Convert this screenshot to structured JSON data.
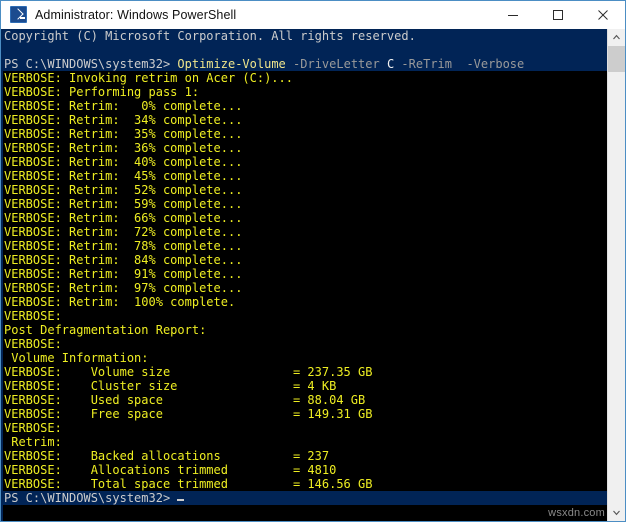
{
  "window": {
    "title": "Administrator: Windows PowerShell",
    "icon": "powershell-icon",
    "border_color": "#4c8ec4",
    "controls": {
      "minimize": "—",
      "maximize": "□",
      "close": "✕"
    }
  },
  "console": {
    "background_navy": "#012456",
    "background_black": "#000000",
    "verbose_color": "#eeee22",
    "prompt_color": "#cccccc",
    "header_line": "Copyright (C) Microsoft Corporation. All rights reserved.",
    "prompt": "PS C:\\WINDOWS\\system32>",
    "command": {
      "cmdlet": "Optimize-Volume",
      "param_drive": "-DriveLetter",
      "drive_value": "C",
      "param_retrim": "-ReTrim",
      "param_verbose": "-Verbose"
    },
    "verbose_lines": [
      "VERBOSE: Invoking retrim on Acer (C:)...",
      "VERBOSE: Performing pass 1:",
      "VERBOSE: Retrim:   0% complete...",
      "VERBOSE: Retrim:  34% complete...",
      "VERBOSE: Retrim:  35% complete...",
      "VERBOSE: Retrim:  36% complete...",
      "VERBOSE: Retrim:  40% complete...",
      "VERBOSE: Retrim:  45% complete...",
      "VERBOSE: Retrim:  52% complete...",
      "VERBOSE: Retrim:  59% complete...",
      "VERBOSE: Retrim:  66% complete...",
      "VERBOSE: Retrim:  72% complete...",
      "VERBOSE: Retrim:  78% complete...",
      "VERBOSE: Retrim:  84% complete...",
      "VERBOSE: Retrim:  91% complete...",
      "VERBOSE: Retrim:  97% complete...",
      "VERBOSE: Retrim:  100% complete.",
      "VERBOSE:",
      "Post Defragmentation Report:",
      "VERBOSE:",
      " Volume Information:",
      "VERBOSE:    Volume size                 = 237.35 GB",
      "VERBOSE:    Cluster size                = 4 KB",
      "VERBOSE:    Used space                  = 88.04 GB",
      "VERBOSE:    Free space                  = 149.31 GB",
      "VERBOSE:",
      " Retrim:",
      "VERBOSE:    Backed allocations          = 237",
      "VERBOSE:    Allocations trimmed         = 4810",
      "VERBOSE:    Total space trimmed         = 146.56 GB"
    ],
    "final_prompt": "PS C:\\WINDOWS\\system32>",
    "report": {
      "title": "Post Defragmentation Report:",
      "volume_information_label": " Volume Information:",
      "retrim_label": " Retrim:",
      "volume_size": "237.35 GB",
      "cluster_size": "4 KB",
      "used_space": "88.04 GB",
      "free_space": "149.31 GB",
      "backed_allocations": "237",
      "allocations_trimmed": "4810",
      "total_space_trimmed": "146.56 GB"
    }
  },
  "scrollbar": {
    "up_arrow": "∧",
    "down_arrow": "∨",
    "thumb_position": "top"
  },
  "watermark": "wsxdn.com"
}
